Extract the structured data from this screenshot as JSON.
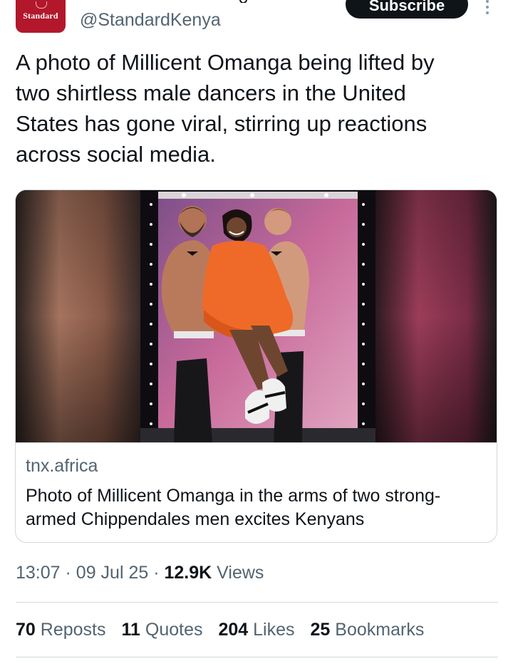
{
  "account": {
    "avatar_logo_text": "Standard",
    "handle": "@StandardKenya",
    "subscribe_label": "Subscribe"
  },
  "tweet": {
    "text": "A photo of Millicent Omanga being lifted by\ntwo shirtless male dancers in the United\nStates has gone viral, stirring up reactions\nacross social media."
  },
  "link_card": {
    "domain": "tnx.africa",
    "title": "Photo of Millicent Omanga in the arms of two strong-armed Chippendales men excites Kenyans"
  },
  "meta": {
    "time": "13:07",
    "date": "09 Jul 25",
    "views_count": "12.9K",
    "views_label": "Views"
  },
  "stats": {
    "reposts_count": "70",
    "reposts_label": "Reposts",
    "quotes_count": "11",
    "quotes_label": "Quotes",
    "likes_count": "204",
    "likes_label": "Likes",
    "bookmarks_count": "25",
    "bookmarks_label": "Bookmarks"
  },
  "colors": {
    "text_primary": "#0f1419",
    "text_secondary": "#536471",
    "border": "#cfd9de",
    "brand_red": "#b3172b",
    "dress_orange": "#ef6a28"
  }
}
